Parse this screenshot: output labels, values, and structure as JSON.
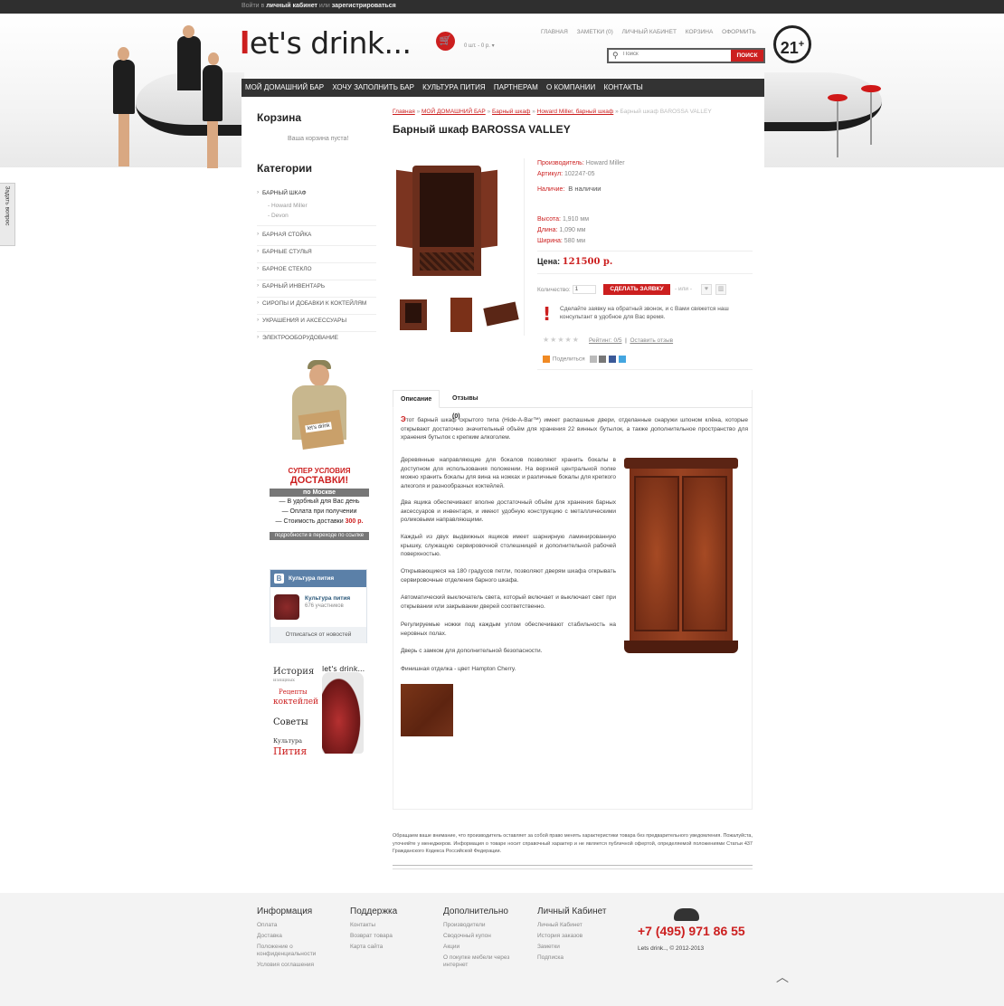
{
  "topbar": {
    "prefix": "Войти в",
    "cabinet": "личный кабинет",
    "or": "или",
    "register": "зарегистрироваться"
  },
  "header": {
    "logo_l": "l",
    "logo_rest": "et's drink...",
    "cart_mini": "0 шт. - 0 р.",
    "nav": [
      "ГЛАВНАЯ",
      "ЗАМЕТКИ (0)",
      "ЛИЧНЫЙ КАБИНЕТ",
      "КОРЗИНА",
      "ОФОРМИТЬ"
    ],
    "search_placeholder": "Поиск",
    "search_button": "ПОИСК",
    "age": "21",
    "age_plus": "+"
  },
  "menu": [
    "МОЙ ДОМАШНИЙ БАР",
    "ХОЧУ ЗАПОЛНИТЬ БАР",
    "КУЛЬТУРА ПИТИЯ",
    "ПАРТНЕРАМ",
    "О КОМПАНИИ",
    "КОНТАКТЫ"
  ],
  "sidebar": {
    "cart_title": "Корзина",
    "cart_empty": "Ваша корзина пуста!",
    "cat_title": "Категории",
    "categories": [
      "БАРНЫЙ ШКАФ",
      "БАРНАЯ СТОЙКА",
      "БАРНЫЕ СТУЛЬЯ",
      "БАРНОЕ СТЕКЛО",
      "БАРНЫЙ ИНВЕНТАРЬ",
      "СИРОПЫ И ДОБАВКИ К КОКТЕЙЛЯМ",
      "УКРАШЕНИЯ И АКСЕССУАРЫ",
      "ЭЛЕКТРООБОРУДОВАНИЕ"
    ],
    "subcats": [
      "- Howard Miller",
      "- Devon"
    ],
    "promo": {
      "box_label": "let's drink",
      "line1": "СУПЕР УСЛОВИЯ",
      "line2": "ДОСТАВКИ!",
      "bar": "по Москве",
      "items": [
        "В удобный для Вас день",
        "Оплата при получении"
      ],
      "cost_prefix": "Стоимость доставки",
      "cost_value": "300 р.",
      "footer": "подробности в переходе по ссылке"
    },
    "vk": {
      "head": "Культура пития",
      "name": "Культура пития",
      "members": "676 участников",
      "subscribe": "Отписаться от новостей",
      "logo": "B"
    },
    "culture": {
      "t1": "История",
      "t1s": "изящных",
      "t2": "Рецепты",
      "t3": "коктейлей",
      "t4": "Советы",
      "t5": "Культура",
      "t6": "Пития",
      "logo": "let's drink..."
    }
  },
  "breadcrumb": {
    "home": "Главная",
    "sep": "»",
    "c1": "МОЙ ДОМАШНИЙ БАР",
    "c2": "Барный шкаф",
    "c3": "Howard Miller, барный шкаф",
    "current": "Барный шкаф BAROSSA VALLEY"
  },
  "product": {
    "title": "Барный шкаф BAROSSA VALLEY",
    "maker_label": "Производитель:",
    "maker": "Howard Miller",
    "sku_label": "Артикул:",
    "sku": "102247-05",
    "stock_label": "Наличие:",
    "stock": "В наличии",
    "height_label": "Высота:",
    "height": "1,910 мм",
    "length_label": "Длина:",
    "length": "1,090 мм",
    "width_label": "Ширина:",
    "width": "580 мм",
    "price_label": "Цена:",
    "price": "121500 р.",
    "qty_label": "Количество:",
    "qty": "1",
    "order_button": "СДЕЛАТЬ ЗАЯВКУ",
    "or": "- или -",
    "callback": "Сделайте заявку на обратный звонок, и с Вами свяжется наш консультант в удобное для Вас время.",
    "stars": "★★★★★",
    "rating": "Рейтинг: 0/5",
    "review_link": "Оставить отзыв",
    "share": "Поделиться"
  },
  "tabs": [
    "Описание",
    "Отзывы (0)"
  ],
  "description": [
    "тот барный шкаф скрытого типа (Hide-A-Bar™) имеет распашные двери, отделанные снаружи шпоном клёна, которые открывают достаточно значительный объём для хранения 22 винных бутылок, а также дополнительное пространство для хранения бутылок с крепким алкоголем.",
    "Деревянные направляющие для бокалов позволяют хранить бокалы в доступном для использования положении. На верхней центральной полке можно хранить бокалы для вина на ножках и различные бокалы для крепкого алкоголя и разнообразных коктейлей.",
    "Два ящика обеспечивают вполне достаточный объём для хранения барных аксессуаров и инвентаря, и имеют удобную конструкцию с металлическими роликовыми направляющими.",
    "Каждый из двух выдвижных ящиков имеет шарнирную ламинированную крышку, служащую сервировочной столешницей и дополнительной рабочей поверхностью.",
    "Открывающиеся на 180 градусов петли, позволяют дверям шкафа открывать сервировочные отделения барного шкафа.",
    "Автоматический выключатель света, который включает и выключает свет при открывании или закрывании дверей соответственно.",
    "Регулируемые ножки под каждым углом обеспечивают стабильность на неровных полах.",
    "Дверь с замком для дополнительной безопасности.",
    "Финишная отделка - цвет Hampton Cherry."
  ],
  "description_cap": "Э",
  "disclaimer": "Обращаем ваше внимание, что производитель оставляет за собой право менять характеристики товара без предварительного уведомления. Пожалуйста, уточняйте у менеджеров. Информация о товаре носит справочный характер и не является публичной офертой, определяемой положениями Статьи 437 Гражданского Кодекса Российской Федерации.",
  "footer": {
    "cols": [
      {
        "title": "Информация",
        "items": [
          "Оплата",
          "Доставка",
          "Положение о конфиденциальности",
          "Условия соглашения"
        ]
      },
      {
        "title": "Поддержка",
        "items": [
          "Контакты",
          "Возврат товара",
          "Карта сайта"
        ]
      },
      {
        "title": "Дополнительно",
        "items": [
          "Производители",
          "Сводочный купон",
          "Акции",
          "О покупке мебели через интернет"
        ]
      },
      {
        "title": "Личный Кабинет",
        "items": [
          "Личный Кабинет",
          "История заказов",
          "Заметки",
          "Подписка"
        ]
      }
    ],
    "phone": "+7 (495) 971 86 55",
    "copyright": "Lets drink.., © 2012-2013"
  },
  "ask": "Задать вопрос",
  "colors": {
    "accent": "#cc1f1f",
    "menu": "#333333",
    "topbar": "#2f2f2f"
  }
}
